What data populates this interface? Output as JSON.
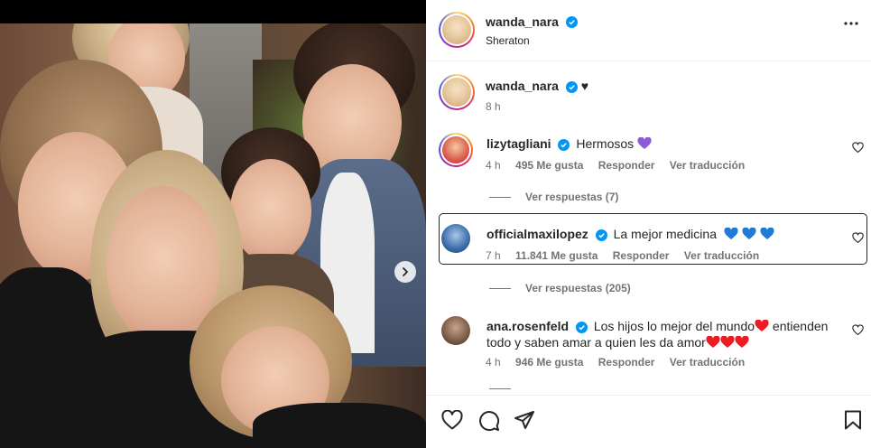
{
  "post": {
    "author": "wanda_nara",
    "location": "Sheraton",
    "caption_suffix": "♥",
    "caption_time": "8 h"
  },
  "comments": [
    {
      "user": "lizytagliani",
      "text": "Hermosos",
      "time": "4 h",
      "likes": "495 Me gusta",
      "reply": "Responder",
      "translate": "Ver traducción",
      "view_replies": "Ver respuestas (7)"
    },
    {
      "user": "officialmaxilopez",
      "text": "La mejor medicina",
      "time": "7 h",
      "likes": "11.841 Me gusta",
      "reply": "Responder",
      "translate": "Ver traducción",
      "view_replies": "Ver respuestas (205)"
    },
    {
      "user": "ana.rosenfeld",
      "text_part1": "Los hijos lo mejor del mundo",
      "text_part2": "entienden",
      "text_part3": "todo y saben amar a quien les da amor",
      "time": "4 h",
      "likes": "946 Me gusta",
      "reply": "Responder",
      "translate": "Ver traducción"
    }
  ],
  "colors": {
    "verified": "#0095f6",
    "text": "#262626",
    "muted": "#737373",
    "heart_red": "#ed1c24",
    "heart_blue": "#1f7bd6",
    "heart_purple": "#8c5cd6"
  }
}
